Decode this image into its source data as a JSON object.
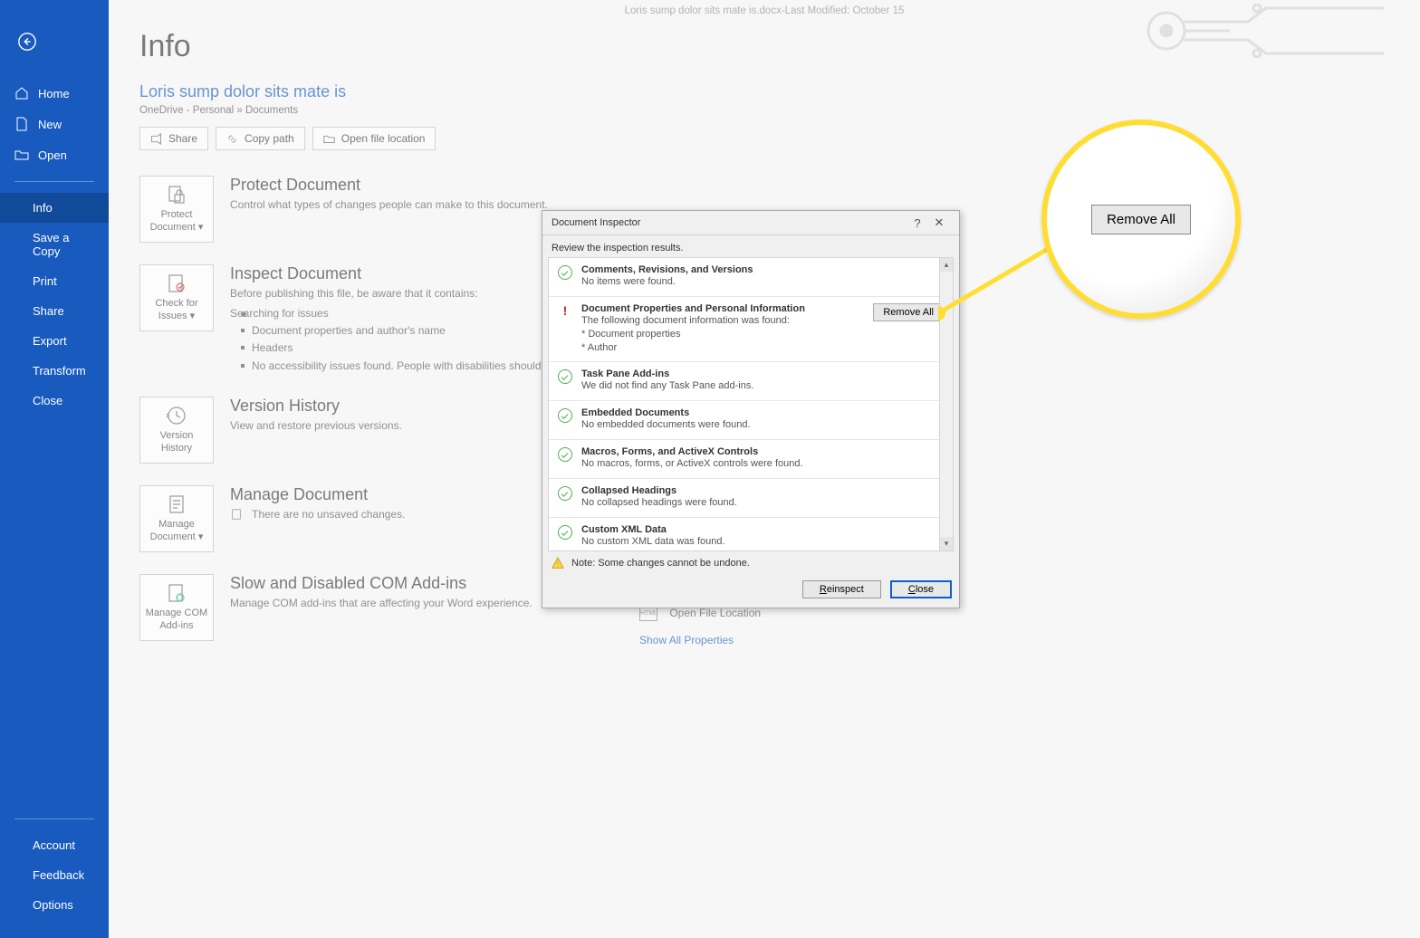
{
  "titlebar": {
    "filename": "Loris sump dolor sits mate is.docx",
    "sep": " - ",
    "modified": "Last Modified: October 15"
  },
  "sidebar": {
    "home": "Home",
    "new": "New",
    "open": "Open",
    "info": "Info",
    "saveCopy": "Save a Copy",
    "print": "Print",
    "share": "Share",
    "export": "Export",
    "transform": "Transform",
    "close": "Close",
    "account": "Account",
    "feedback": "Feedback",
    "options": "Options"
  },
  "page": {
    "title": "Info",
    "docTitle": "Loris sump dolor sits mate is",
    "docPath": "OneDrive - Personal » Documents",
    "shareBtn": "Share",
    "copyPathBtn": "Copy path",
    "openLocBtn": "Open file location"
  },
  "protect": {
    "btn": "Protect Document",
    "h": "Protect Document",
    "p": "Control what types of changes people can make to this document."
  },
  "inspect": {
    "btn": "Check for Issues",
    "h": "Inspect Document",
    "p": "Before publishing this file, be aware that it contains:",
    "li1": "Searching for issues",
    "li2": "Document properties and author's name",
    "li3": "Headers",
    "li4": "No accessibility issues found. People with disabilities should not have reading this document."
  },
  "version": {
    "btn": "Version History",
    "h": "Version History",
    "p": "View and restore previous versions."
  },
  "manage": {
    "btn": "Manage Document",
    "h": "Manage Document",
    "p": "There are no unsaved changes."
  },
  "com": {
    "btn": "Manage COM Add-ins",
    "h": "Slow and Disabled COM Add-ins",
    "p": "Manage COM add-ins that are affecting your Word experience."
  },
  "rel": {
    "openLoc": "Open File Location",
    "showAll": "Show All Properties"
  },
  "dialog": {
    "title": "Document Inspector",
    "sub": "Review the inspection results.",
    "rows": [
      {
        "status": "ok",
        "t": "Comments, Revisions, and Versions",
        "d": "No items were found."
      },
      {
        "status": "warn",
        "t": "Document Properties and Personal Information",
        "d": "The following document information was found:\n* Document properties\n* Author",
        "btn": "Remove All"
      },
      {
        "status": "ok",
        "t": "Task Pane Add-ins",
        "d": "We did not find any Task Pane add-ins."
      },
      {
        "status": "ok",
        "t": "Embedded Documents",
        "d": "No embedded documents were found."
      },
      {
        "status": "ok",
        "t": "Macros, Forms, and ActiveX Controls",
        "d": "No macros, forms, or ActiveX controls were found."
      },
      {
        "status": "ok",
        "t": "Collapsed Headings",
        "d": "No collapsed headings were found."
      },
      {
        "status": "ok",
        "t": "Custom XML Data",
        "d": "No custom XML data was found."
      }
    ],
    "note": "Note: Some changes cannot be undone.",
    "reinspect": "Reinspect",
    "close": "Close"
  },
  "callout": {
    "btn": "Remove All"
  }
}
